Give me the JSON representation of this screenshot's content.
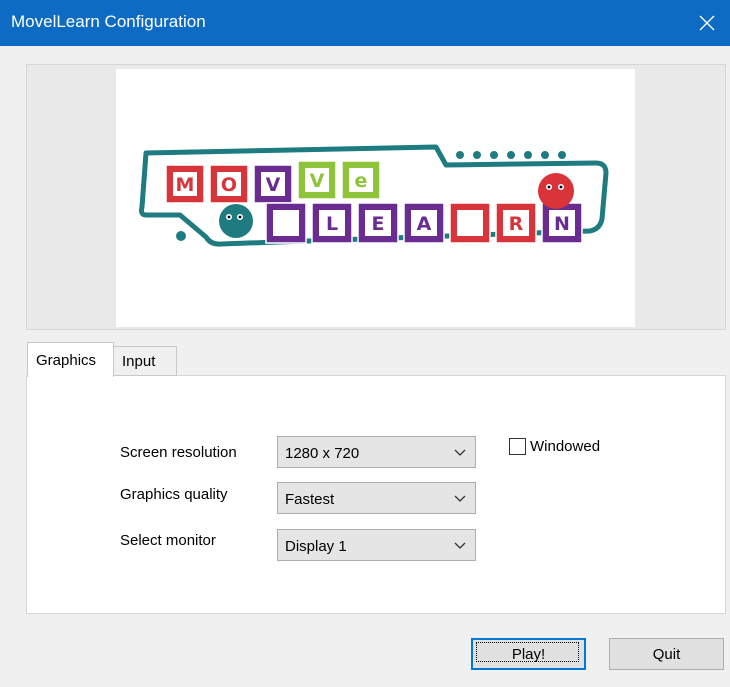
{
  "window": {
    "title": "MovelLearn Configuration"
  },
  "logo": {
    "top_letters": [
      "M",
      "O",
      "V",
      "e"
    ],
    "bottom_letters": [
      "L",
      "E",
      "A",
      "R",
      "N"
    ],
    "colors": {
      "teal": "#1e7b80",
      "red": "#d9343a",
      "green": "#8fc33a",
      "purple": "#6b2c91",
      "orange": "#e06a2b"
    }
  },
  "tabs": [
    {
      "label": "Graphics",
      "active": true
    },
    {
      "label": "Input",
      "active": false
    }
  ],
  "graphics": {
    "resolution_label": "Screen resolution",
    "resolution_value": "1280 x 720",
    "quality_label": "Graphics quality",
    "quality_value": "Fastest",
    "monitor_label": "Select monitor",
    "monitor_value": "Display 1",
    "windowed_label": "Windowed",
    "windowed_checked": false
  },
  "buttons": {
    "play": "Play!",
    "quit": "Quit"
  },
  "icons": {
    "close": "close-icon",
    "dropdown": "chevron-down-icon"
  }
}
